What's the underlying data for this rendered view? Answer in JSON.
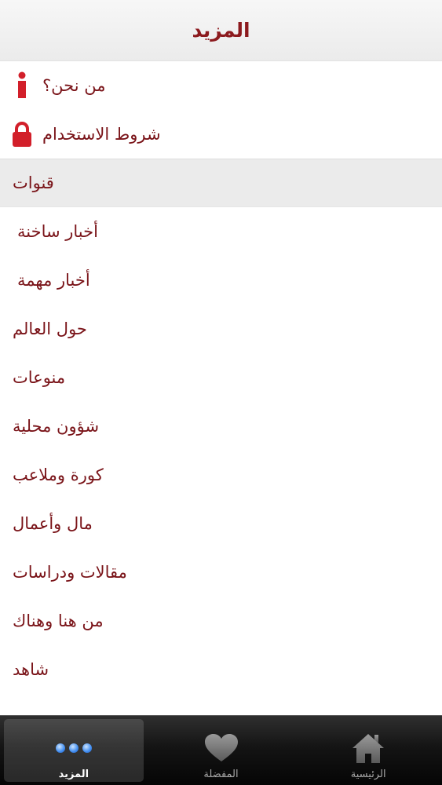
{
  "header": {
    "title": "المزيد"
  },
  "top_items": [
    {
      "label": "من نحن؟",
      "icon": "info-icon",
      "color": "#d21f2a"
    },
    {
      "label": "شروط الاستخدام",
      "icon": "lock-icon",
      "color": "#d21f2a"
    }
  ],
  "section": {
    "label": "قنوات"
  },
  "channels": [
    {
      "label": "أخبار ساخنة"
    },
    {
      "label": "أخبار مهمة"
    },
    {
      "label": "حول العالم"
    },
    {
      "label": "منوعات"
    },
    {
      "label": "شؤون محلية"
    },
    {
      "label": "كورة وملاعب"
    },
    {
      "label": "مال وأعمال"
    },
    {
      "label": "مقالات ودراسات"
    },
    {
      "label": "من هنا وهناك"
    },
    {
      "label": "شاهد"
    }
  ],
  "tabbar": {
    "tabs": [
      {
        "label": "المزيد",
        "icon": "more-dots-icon",
        "active": true
      },
      {
        "label": "المفضلة",
        "icon": "heart-icon",
        "active": false
      },
      {
        "label": "الرئيسية",
        "icon": "home-icon",
        "active": false
      }
    ]
  },
  "colors": {
    "accent": "#7a1419",
    "icon_red": "#d21f2a"
  }
}
